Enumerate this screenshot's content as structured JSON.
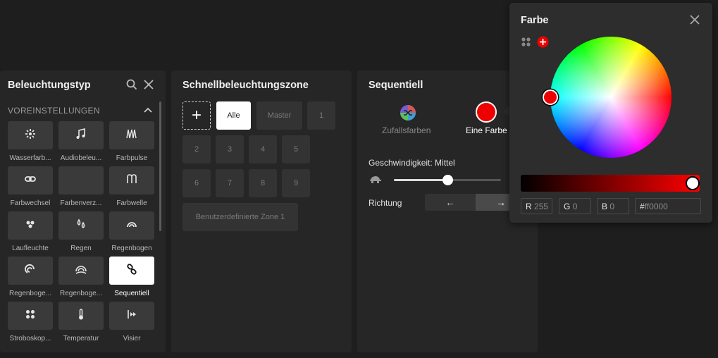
{
  "lighting_type": {
    "title": "Beleuchtungstyp",
    "section": "VOREINSTELLUNGEN",
    "tiles": [
      {
        "label": "Wasserfarb...",
        "icon": "waterfall-icon",
        "active": false
      },
      {
        "label": "Audiobeleu...",
        "icon": "music-note-icon",
        "active": false
      },
      {
        "label": "Farbpulse",
        "icon": "pulse-icon",
        "active": false
      },
      {
        "label": "Farbwechsel",
        "icon": "color-cycle-icon",
        "active": false
      },
      {
        "label": "Farbenverz...",
        "icon": "color-shift-icon",
        "active": false
      },
      {
        "label": "Farbwelle",
        "icon": "wave-icon",
        "active": false
      },
      {
        "label": "Laufleuchte",
        "icon": "marquee-icon",
        "active": false
      },
      {
        "label": "Regen",
        "icon": "rain-icon",
        "active": false
      },
      {
        "label": "Regenbogen",
        "icon": "rainbow-icon",
        "active": false
      },
      {
        "label": "Regenboge...",
        "icon": "rainbow-spiral-icon",
        "active": false
      },
      {
        "label": "Regenboge...",
        "icon": "rainbow-wave-icon",
        "active": false
      },
      {
        "label": "Sequentiell",
        "icon": "sequential-icon",
        "active": true
      },
      {
        "label": "Stroboskop...",
        "icon": "strobe-icon",
        "active": false
      },
      {
        "label": "Temperatur",
        "icon": "thermometer-icon",
        "active": false
      },
      {
        "label": "Visier",
        "icon": "visor-icon",
        "active": false
      }
    ]
  },
  "quick_zone": {
    "title": "Schnellbeleuchtungszone",
    "add": "+",
    "all": "Alle",
    "master": "Master",
    "zones": [
      "1",
      "2",
      "3",
      "4",
      "5",
      "6",
      "7",
      "8",
      "9"
    ],
    "custom": "Benutzerdefinierte Zone 1"
  },
  "sequential": {
    "title": "Sequentiell",
    "random_label": "Zufallsfarben",
    "single_label": "Eine Farbe",
    "speed_label": "Geschwindigkeit: Mittel",
    "speed_value": 0.5,
    "direction_label": "Richtung",
    "dir_left": "←",
    "dir_right": "→",
    "selected_direction": "right"
  },
  "color_popup": {
    "title": "Farbe",
    "r_label": "R",
    "r_value": "255",
    "g_label": "G",
    "g_value": "0",
    "b_label": "B",
    "b_value": "0",
    "hex_prefix": "#",
    "hex_value": "ff0000",
    "brightness": 1.0,
    "colors": {
      "selected": "#ff0000",
      "accent": "#ffffff"
    }
  }
}
